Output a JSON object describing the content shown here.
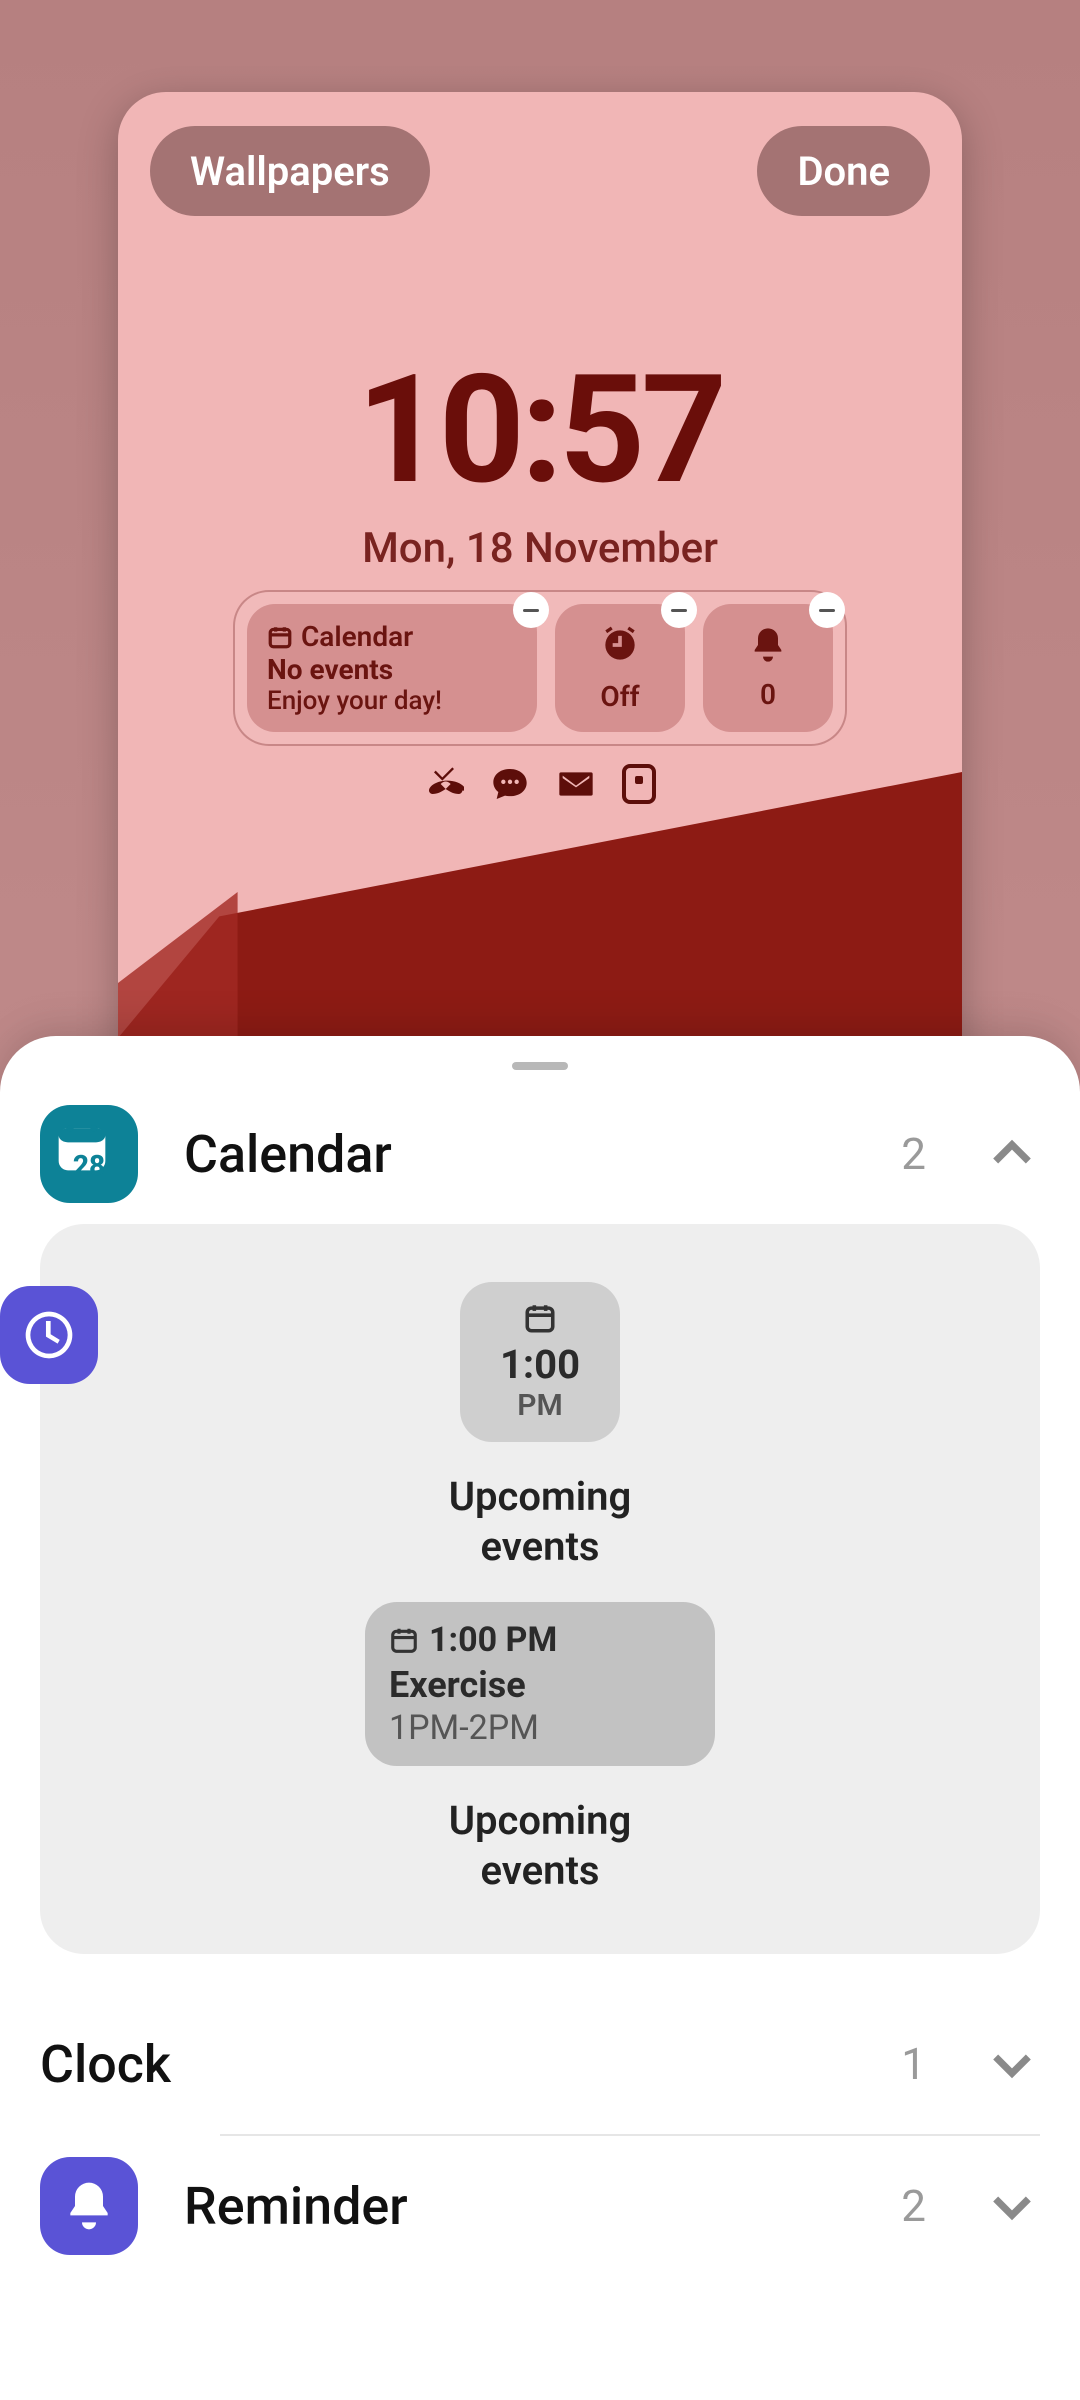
{
  "lockscreen": {
    "wallpapers_label": "Wallpapers",
    "done_label": "Done",
    "time": "10:57",
    "date": "Mon, 18 November",
    "widgets": {
      "calendar": {
        "title": "Calendar",
        "line1": "No events",
        "line2": "Enjoy your day!"
      },
      "alarm": {
        "caption": "Off"
      },
      "bell": {
        "caption": "0"
      }
    }
  },
  "sheet": {
    "sections": {
      "calendar": {
        "name": "Calendar",
        "count": "2",
        "icon_day": "28",
        "previews": {
          "small": {
            "t1": "1:00",
            "t2": "PM",
            "label": "Upcoming\nevents"
          },
          "wide": {
            "time": "1:00 PM",
            "title": "Exercise",
            "range": "1PM-2PM",
            "label": "Upcoming\nevents"
          }
        }
      },
      "clock": {
        "name": "Clock",
        "count": "1"
      },
      "reminder": {
        "name": "Reminder",
        "count": "2"
      }
    }
  }
}
